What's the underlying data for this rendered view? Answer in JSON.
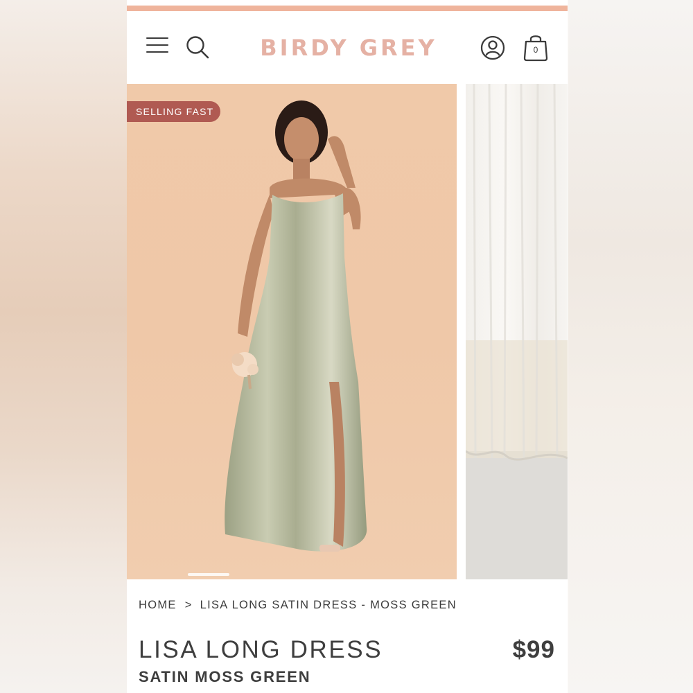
{
  "brand": {
    "logo_text": "BIRDY GREY",
    "accent_color": "#efb49c",
    "logo_color": "#e5b1a4"
  },
  "header": {
    "icons": [
      "menu-icon",
      "search-icon",
      "account-icon",
      "shopping-bag-icon"
    ],
    "cart_count": "0"
  },
  "gallery": {
    "badge": "SELLING FAST",
    "badge_color": "#b05a52",
    "main_image": "model in long satin moss green slip dress holding bouquet",
    "second_image": "white curtain backdrop over grey floor"
  },
  "breadcrumb": {
    "home": "HOME",
    "separator": ">",
    "current": "LISA LONG SATIN DRESS - MOSS GREEN"
  },
  "product": {
    "title": "LISA LONG DRESS",
    "subtitle": "SATIN MOSS GREEN",
    "price": "$99"
  }
}
